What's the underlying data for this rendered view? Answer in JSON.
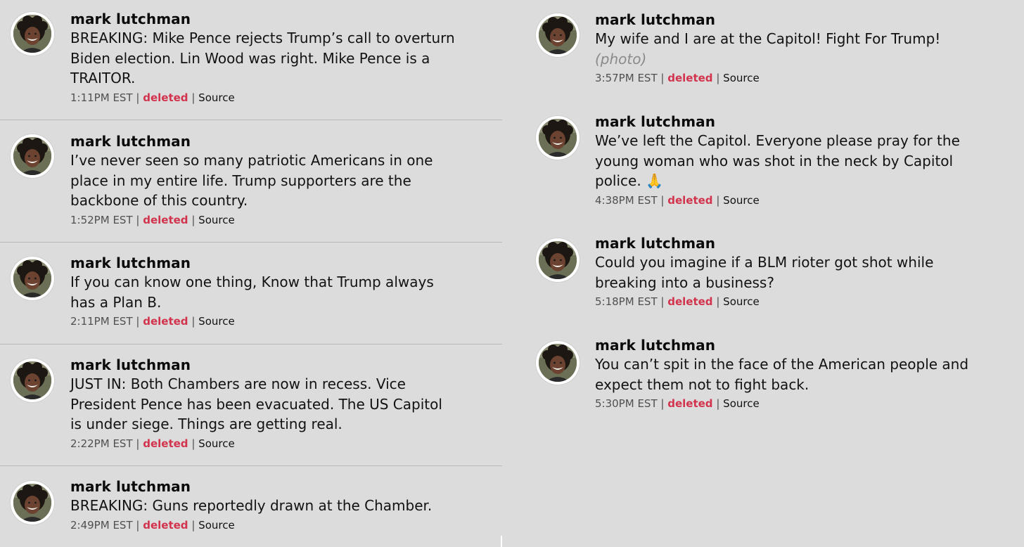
{
  "author": "mark lutchman",
  "separator": "|",
  "left_posts": [
    {
      "text": "BREAKING: Mike Pence rejects Trump’s call to overturn\nBiden election. Lin Wood was right. Mike Pence is a\nTRAITOR.",
      "time": "1:11PM EST",
      "status": "deleted",
      "source": "Source"
    },
    {
      "text": "I’ve never seen so many patriotic Americans in one\nplace in my entire life. Trump supporters are the\nbackbone of this country.",
      "time": "1:52PM EST",
      "status": "deleted",
      "source": "Source"
    },
    {
      "text": "If you can know one thing, Know that Trump always\nhas a Plan B.",
      "time": "2:11PM EST",
      "status": "deleted",
      "source": "Source"
    },
    {
      "text": "JUST IN: Both Chambers are now in recess. Vice\nPresident Pence has been evacuated. The US Capitol\nis under siege. Things are getting real.",
      "time": "2:22PM EST",
      "status": "deleted",
      "source": "Source"
    },
    {
      "text": "BREAKING: Guns reportedly drawn at the Chamber.",
      "time": "2:49PM EST",
      "status": "deleted",
      "source": "Source"
    }
  ],
  "right_posts": [
    {
      "text": "My wife and I are at the Capitol! Fight For Trump!",
      "attachment": "(photo)",
      "time": "3:57PM EST",
      "status": "deleted",
      "source": "Source"
    },
    {
      "text": "We’ve left the Capitol. Everyone please pray for the\nyoung woman who was shot in the neck by Capitol\npolice. 🙏",
      "time": "4:38PM EST",
      "status": "deleted",
      "source": "Source"
    },
    {
      "text": "Could you imagine if a BLM rioter got shot while\nbreaking into a business?",
      "time": "5:18PM EST",
      "status": "deleted",
      "source": "Source"
    },
    {
      "text": "You can’t spit in the face of the American people and\nexpect them not to fight back.",
      "time": "5:30PM EST",
      "status": "deleted",
      "source": "Source"
    }
  ]
}
